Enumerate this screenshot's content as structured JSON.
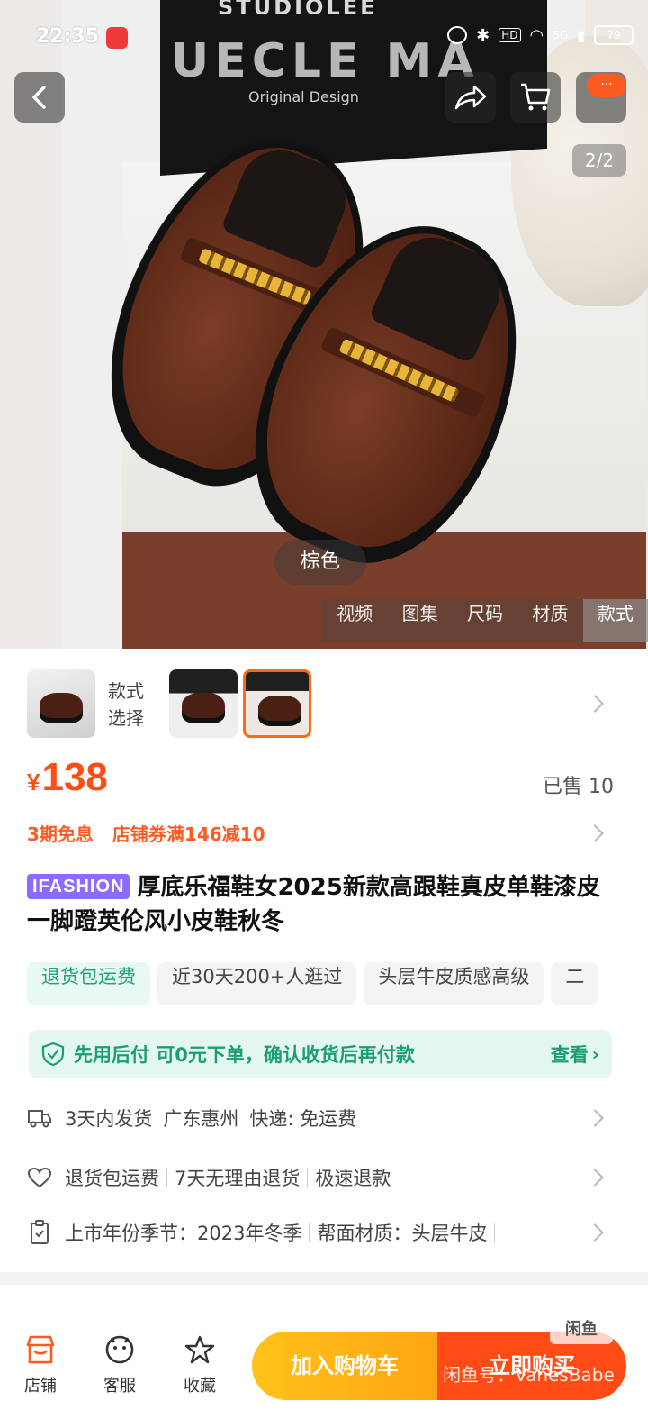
{
  "status_bar": {
    "time": "22:35",
    "signal": "5G",
    "hd": "HD",
    "battery": "79"
  },
  "hero": {
    "brand_top": "STUDIOLEE",
    "brand_main": "UECLE MA",
    "brand_sub": "Original Design",
    "page_indicator": "2/2",
    "color_label": "棕色",
    "media_tabs": [
      "视频",
      "图集",
      "尺码",
      "材质",
      "款式"
    ],
    "active_media_tab": "款式",
    "notification_badge": "···"
  },
  "variants": {
    "label": "款式选择"
  },
  "price": {
    "currency": "¥",
    "amount": "138",
    "sold": "已售 10"
  },
  "promo": {
    "installment": "3期免息",
    "coupon": "店铺券满146减10"
  },
  "product": {
    "tag": "IFASHION",
    "title": "厚底乐福鞋女2025新款高跟鞋真皮单鞋漆皮一脚蹬英伦风小皮鞋秋冬"
  },
  "features": [
    "退货包运费",
    "近30天200+人逛过",
    "头层牛皮质感高级",
    "二"
  ],
  "pay_later": {
    "text": "先用后付 可0元下单，确认收货后再付款",
    "more": "查看"
  },
  "shipping": {
    "days": "3天内发货",
    "location": "广东惠州",
    "fee": "快递: 免运费"
  },
  "returns": {
    "item1": "退货包运费",
    "item2": "7天无理由退货",
    "item3": "极速退款"
  },
  "specs": {
    "season": "上市年份季节：2023年冬季",
    "material": "帮面材质：头层牛皮"
  },
  "bottom_bar": {
    "store": "店铺",
    "service": "客服",
    "favorite": "收藏",
    "add_to_cart": "加入购物车",
    "buy_now": "立即购买"
  },
  "watermark": {
    "logo": "闲鱼",
    "text": "闲鱼号：VanesBabe"
  },
  "colors": {
    "accent": "#ff4e13",
    "green": "#1a9e77",
    "cart": "#ffb41a"
  }
}
